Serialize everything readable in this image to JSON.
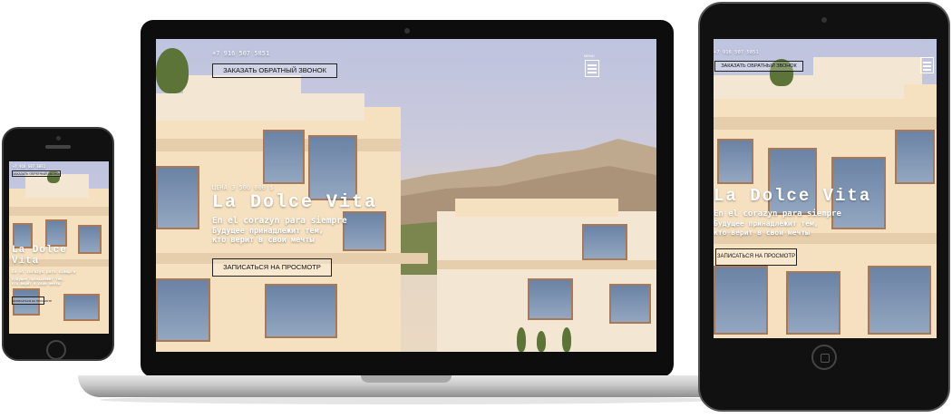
{
  "site": {
    "phone": "+7 916 507 5851",
    "callback_label": "ЗАКАЗАТЬ ОБРАТНЫЙ ЗВОНОК",
    "menu_label": "MENU",
    "price": "ЦЕНА 3 500 000 $",
    "title": "La Dolce Vita",
    "title_phone_line1": "La Dolce",
    "title_phone_line2": "Vita",
    "subtitle": "En el corazyn para siempre",
    "tagline_line1": "Будущее принадлежит тем,",
    "tagline_line2": "кто верит в свои мечты",
    "cta_label": "ЗАПИСАТЬСЯ НА ПРОСМОТР"
  },
  "colors": {
    "sky_top": "#b9c2e6",
    "building": "#f4ead9",
    "frame": "#a07050",
    "device": "#111111"
  }
}
